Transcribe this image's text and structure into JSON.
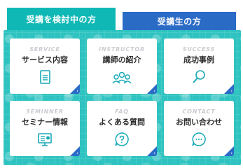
{
  "tabs": {
    "prospective": "受講を検討中の方",
    "current": "受講生の方"
  },
  "cards": [
    {
      "en": "SERVICE",
      "jp": "サービス内容",
      "icon": "document-icon"
    },
    {
      "en": "INSTRUCTOR",
      "jp": "講師の紹介",
      "icon": "people-icon"
    },
    {
      "en": "SUCCESS",
      "jp": "成功事例",
      "icon": "magnifier-icon"
    },
    {
      "en": "SEMINNER",
      "jp": "セミナー情報",
      "icon": "monitor-icon"
    },
    {
      "en": "FAQ",
      "jp": "よくある質問",
      "icon": "question-icon"
    },
    {
      "en": "CONTACT",
      "jp": "お問い合わせ",
      "icon": "chat-icon"
    }
  ],
  "colors": {
    "teal": "#0fb8b5",
    "blue": "#2a6bc6",
    "icon": "#16a9b6"
  }
}
